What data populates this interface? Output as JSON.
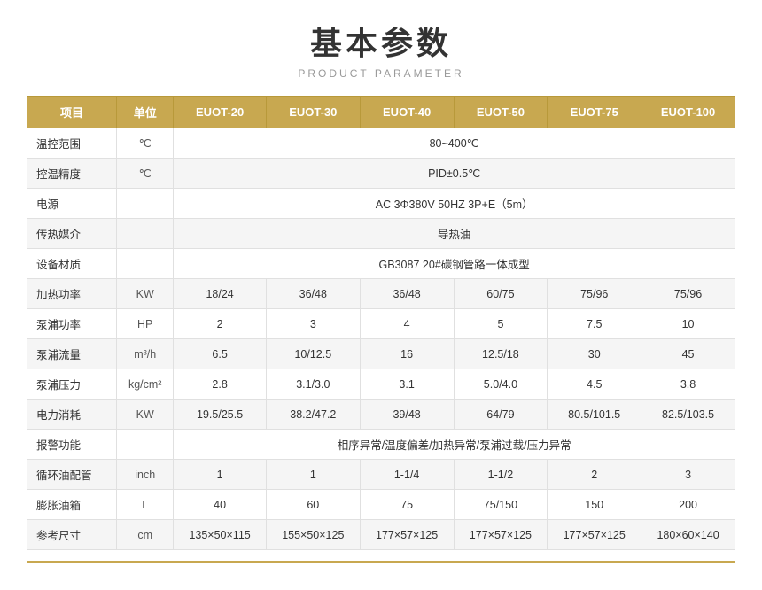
{
  "title": "基本参数",
  "subtitle": "PRODUCT PARAMETER",
  "table": {
    "headers": [
      "项目",
      "单位",
      "EUOT-20",
      "EUOT-30",
      "EUOT-40",
      "EUOT-50",
      "EUOT-75",
      "EUOT-100"
    ],
    "rows": [
      {
        "cells": [
          "温控范围",
          "℃",
          {
            "colspan": 6,
            "value": "80~400℃"
          }
        ]
      },
      {
        "cells": [
          "控温精度",
          "℃",
          {
            "colspan": 6,
            "value": "PID±0.5℃"
          }
        ]
      },
      {
        "cells": [
          "电源",
          "",
          {
            "colspan": 6,
            "value": "AC 3Φ380V 50HZ  3P+E（5m）"
          }
        ]
      },
      {
        "cells": [
          "传热媒介",
          "",
          {
            "colspan": 6,
            "value": "导热油"
          }
        ]
      },
      {
        "cells": [
          "设备材质",
          "",
          {
            "colspan": 6,
            "value": "GB3087   20#碳钢管路一体成型"
          }
        ]
      },
      {
        "cells": [
          "加热功率",
          "KW",
          "18/24",
          "36/48",
          "36/48",
          "60/75",
          "75/96",
          "75/96"
        ]
      },
      {
        "cells": [
          "泵浦功率",
          "HP",
          "2",
          "3",
          "4",
          "5",
          "7.5",
          "10"
        ]
      },
      {
        "cells": [
          "泵浦流量",
          "m³/h",
          "6.5",
          "10/12.5",
          "16",
          "12.5/18",
          "30",
          "45"
        ]
      },
      {
        "cells": [
          "泵浦压力",
          "kg/cm²",
          "2.8",
          "3.1/3.0",
          "3.1",
          "5.0/4.0",
          "4.5",
          "3.8"
        ]
      },
      {
        "cells": [
          "电力消耗",
          "KW",
          "19.5/25.5",
          "38.2/47.2",
          "39/48",
          "64/79",
          "80.5/101.5",
          "82.5/103.5"
        ]
      },
      {
        "cells": [
          "报警功能",
          "",
          {
            "colspan": 6,
            "value": "相序异常/温度偏差/加热异常/泵浦过载/压力异常"
          }
        ]
      },
      {
        "cells": [
          "循环油配管",
          "inch",
          "1",
          "1",
          "1-1/4",
          "1-1/2",
          "2",
          "3"
        ]
      },
      {
        "cells": [
          "膨胀油箱",
          "L",
          "40",
          "60",
          "75",
          "75/150",
          "150",
          "200"
        ]
      },
      {
        "cells": [
          "参考尺寸",
          "cm",
          "135×50×115",
          "155×50×125",
          "177×57×125",
          "177×57×125",
          "177×57×125",
          "180×60×140"
        ]
      }
    ]
  }
}
